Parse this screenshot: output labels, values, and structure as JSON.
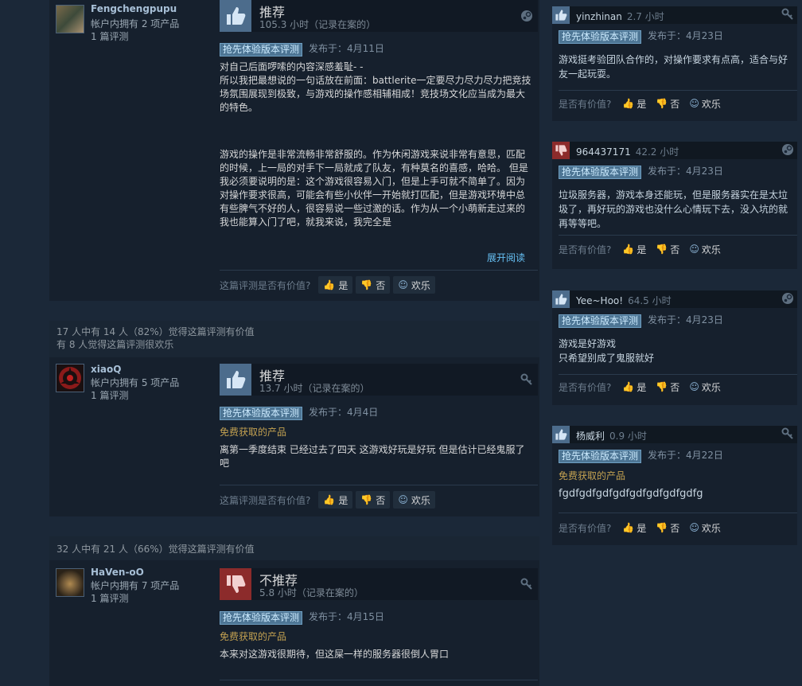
{
  "reviews": [
    {
      "author": "Fengchengpupu",
      "products": "帐户内拥有 2 项产品",
      "review_count": "1 篇评测",
      "verdict": "推荐",
      "hours": "105.3 小时（记录在案的）",
      "badge": "抢先体验版本评测",
      "posted": "发布于：4月11日",
      "paragraphs": [
        "对自己后面啰嗦的内容深感羞耻- -",
        "所以我把最想说的一句话放在前面：battlerite一定要尽力尽力尽力把竞技场氛围展现到极致，与游戏的操作感相辅相成！竞技场文化应当成为最大的特色。",
        "",
        "",
        "游戏的操作是非常流畅非常舒服的。作为休闲游戏来说非常有意思，匹配的时候，上一局的对手下一局就成了队友，有种莫名的喜感，哈哈。 但是我必须要说明的是：这个游戏很容易入门，但是上手可就不简单了。因为对操作要求很高，可能会有些小伙伴一开始就打匹配，但是游戏环境中总有些脾气不好的人，很容易说一些过激的话。作为从一个小萌新走过来的我也能算入门了吧，就我来说，我完全是"
      ],
      "read_more": "展开阅读",
      "helpful_q": "这篇评测是否有价值?",
      "yes": "是",
      "no": "否",
      "funny": "欢乐"
    },
    {
      "stats1": "17 人中有 14 人（82%）觉得这篇评测有价值",
      "stats2": "有 8 人觉得这篇评测很欢乐",
      "author": "xiaoQ",
      "products": "帐户内拥有 5 项产品",
      "review_count": "1 篇评测",
      "verdict": "推荐",
      "hours": "13.7 小时（记录在案的）",
      "badge": "抢先体验版本评测",
      "posted": "发布于：4月4日",
      "free": "免费获取的产品",
      "text": "离第一季度结束 已经过去了四天 这游戏好玩是好玩 但是估计已经鬼服了吧",
      "helpful_q": "这篇评测是否有价值?",
      "yes": "是",
      "no": "否",
      "funny": "欢乐"
    },
    {
      "stats1": "32 人中有 21 人（66%）觉得这篇评测有价值",
      "author": "HaVen-oO",
      "products": "帐户内拥有 7 项产品",
      "review_count": "1 篇评测",
      "verdict": "不推荐",
      "hours": "5.8 小时（记录在案的）",
      "badge": "抢先体验版本评测",
      "posted": "发布于：4月15日",
      "free": "免费获取的产品",
      "text": "本来对这游戏很期待，但这屎一样的服务器很倒人胃口"
    }
  ],
  "side_reviews": [
    {
      "author": "yinzhinan",
      "hours": "2.7 小时",
      "badge": "抢先体验版本评测",
      "posted": "发布于：4月23日",
      "text": "游戏挺考验团队合作的，对操作要求有点高，适合与好友一起玩耍。",
      "helpful_q": "是否有价值?",
      "yes": "是",
      "no": "否",
      "funny": "欢乐"
    },
    {
      "author": "964437171",
      "hours": "42.2 小时",
      "badge": "抢先体验版本评测",
      "posted": "发布于：4月23日",
      "text": "垃圾服务器，游戏本身还能玩，但是服务器实在是太垃圾了，再好玩的游戏也没什么心情玩下去，没入坑的就再等等吧。",
      "helpful_q": "是否有价值?",
      "yes": "是",
      "no": "否",
      "funny": "欢乐"
    },
    {
      "author": "Yee~Hoo!",
      "hours": "64.5 小时",
      "badge": "抢先体验版本评测",
      "posted": "发布于：4月23日",
      "text1": "游戏是好游戏",
      "text2": "只希望别成了鬼服就好",
      "helpful_q": "是否有价值?",
      "yes": "是",
      "no": "否",
      "funny": "欢乐"
    },
    {
      "author": "杨威利",
      "hours": "0.9 小时",
      "badge": "抢先体验版本评测",
      "posted": "发布于：4月22日",
      "free": "免费获取的产品",
      "text": "fgdfgdfgdfgdfgdfgdfgdfgdfg",
      "helpful_q": "是否有价值?",
      "yes": "是",
      "no": "否",
      "funny": "欢乐"
    }
  ],
  "colors": {
    "background": "#1b2838",
    "panel": "#16202d",
    "thumb_up": "#4c6c8c",
    "thumb_down": "#8c2b2b",
    "link": "#66c0f4",
    "free_product": "#c3a151"
  }
}
